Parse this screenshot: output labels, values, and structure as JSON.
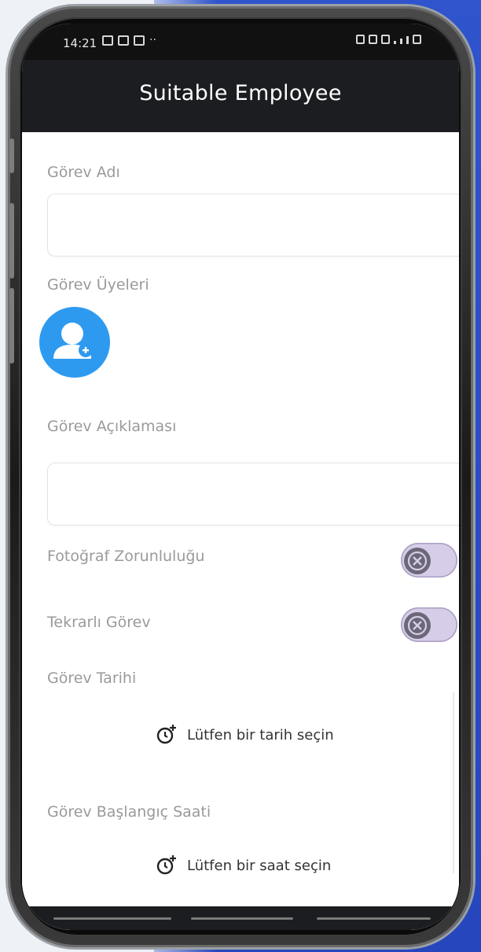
{
  "status_bar": {
    "time": "14:21",
    "overflow": "··"
  },
  "app_bar": {
    "title": "Suitable Employee"
  },
  "form": {
    "task_name_label": "Görev Adı",
    "task_name_value": "",
    "members_label": "Görev Üyeleri",
    "description_label": "Görev Açıklaması",
    "description_value": "",
    "photo_required_label": "Fotoğraf Zorunluluğu",
    "photo_required_on": false,
    "recurring_label": "Tekrarlı Görev",
    "recurring_on": false,
    "date_label": "Görev Tarihi",
    "date_prompt": "Lütfen bir tarih seçin",
    "start_time_label": "Görev Başlangıç Saati",
    "time_prompt": "Lütfen bir saat seçin"
  },
  "icons": {
    "add_member": "person-add-icon",
    "date_picker": "alarm-add-icon",
    "time_picker": "alarm-add-icon",
    "toggle_off": "close-circle-icon"
  },
  "colors": {
    "app_bar": "#1c1d21",
    "accent_blue": "#2d9af0",
    "toggle_track": "#d6cde8",
    "toggle_knob": "#6d6878",
    "label_gray": "#9a9a9a"
  }
}
